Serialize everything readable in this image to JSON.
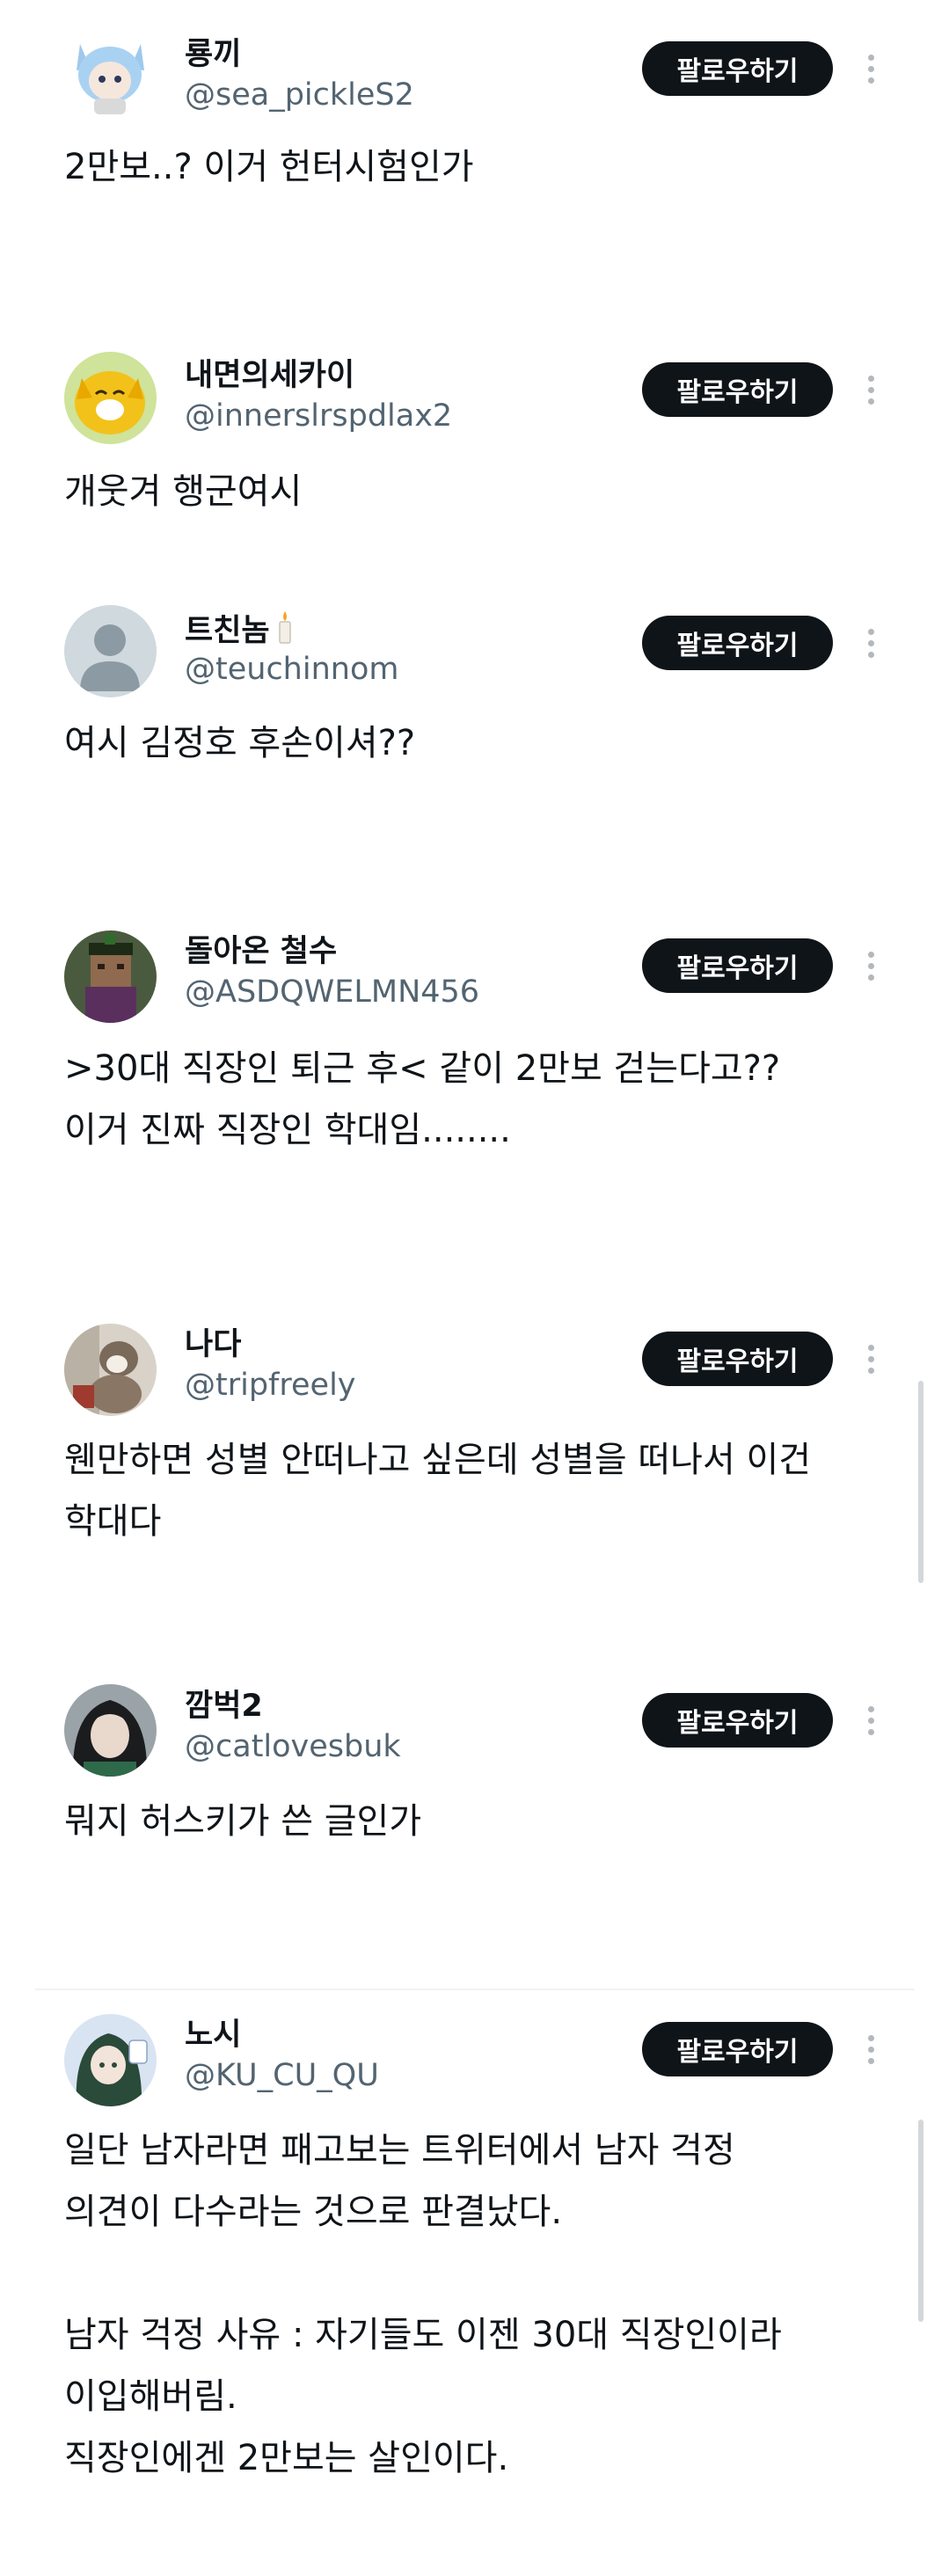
{
  "follow_label": "팔로우하기",
  "posts": [
    {
      "name": "룡끼",
      "handle": "@sea_pickleS2",
      "text": "2만보..? 이거 헌터시험인가"
    },
    {
      "name": "내면의세카이",
      "handle": "@innerslrspdlax2",
      "text": "개웃겨 행군여시"
    },
    {
      "name": "트친놈",
      "handle": "@teuchinnom",
      "text": "여시 김정호 후손이셔??"
    },
    {
      "name": "돌아온 철수",
      "handle": "@ASDQWELMN456",
      "text": ">30대 직장인 퇴근 후< 같이 2만보 걷는다고??\n이거 진짜 직장인 학대임........"
    },
    {
      "name": "나다",
      "handle": "@tripfreely",
      "text": "웬만하면 성별 안떠나고 싶은데 성별을 떠나서 이건\n학대다"
    },
    {
      "name": "깜벅2",
      "handle": "@catlovesbuk",
      "text": "뭐지 허스키가 쓴 글인가"
    },
    {
      "name": "노시",
      "handle": "@KU_CU_QU",
      "text": "일단 남자라면 패고보는 트위터에서 남자 걱정\n의견이 다수라는 것으로 판결났다.\n\n남자 걱정 사유 : 자기들도 이젠 30대 직장인이라\n이입해버림.\n직장인에겐 2만보는 살인이다."
    }
  ]
}
